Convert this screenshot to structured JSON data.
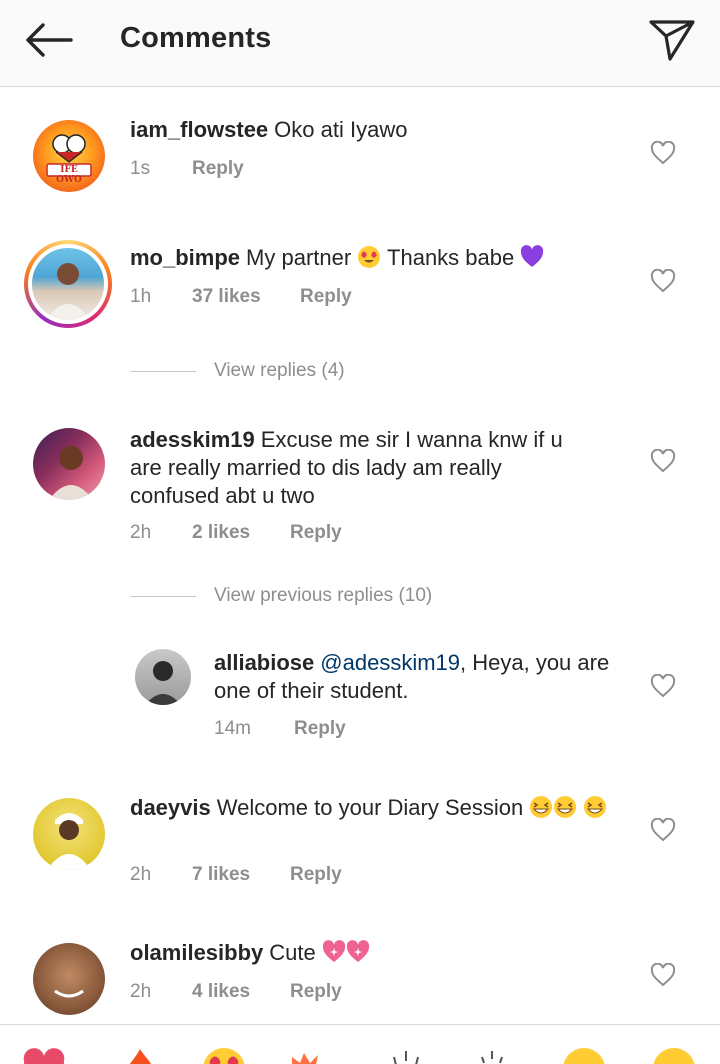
{
  "header": {
    "title": "Comments"
  },
  "comments": [
    {
      "username": "iam_flowstee",
      "text": "Oko ati Iyawo",
      "time": "1s",
      "likes": "",
      "reply": "Reply",
      "avatar_badge": "IFE OWO"
    },
    {
      "username": "mo_bimpe",
      "text_a": "My partner",
      "text_b": "Thanks babe",
      "time": "1h",
      "likes": "37 likes",
      "reply": "Reply"
    },
    {
      "username": "adesskim19",
      "text": "Excuse me sir I wanna knw if u are really married to dis lady am really confused abt u two",
      "time": "2h",
      "likes": "2 likes",
      "reply": "Reply"
    },
    {
      "username": "alliabiose",
      "mention": "@adesskim19",
      "text": ", Heya, you are one of their student.",
      "time": "14m",
      "likes": "",
      "reply": "Reply"
    },
    {
      "username": "daeyvis",
      "text": "Welcome to your Diary Session",
      "time": "2h",
      "likes": "7 likes",
      "reply": "Reply"
    },
    {
      "username": "olamilesibby",
      "text": "Cute",
      "time": "2h",
      "likes": "4 likes",
      "reply": "Reply"
    }
  ],
  "view_replies": {
    "first": "View replies (4)",
    "second": "View previous replies (10)"
  },
  "colors": {
    "accent_link": "#00376b",
    "muted": "#8e8e8e",
    "text": "#262626",
    "heart_purple": "#8a3ee0"
  },
  "icons": [
    "back-arrow-icon",
    "send-icon",
    "heart-outline-icon",
    "heart-eyes-emoji",
    "purple-heart-emoji",
    "grinning-squint-emoji",
    "sparkling-heart-emoji"
  ]
}
